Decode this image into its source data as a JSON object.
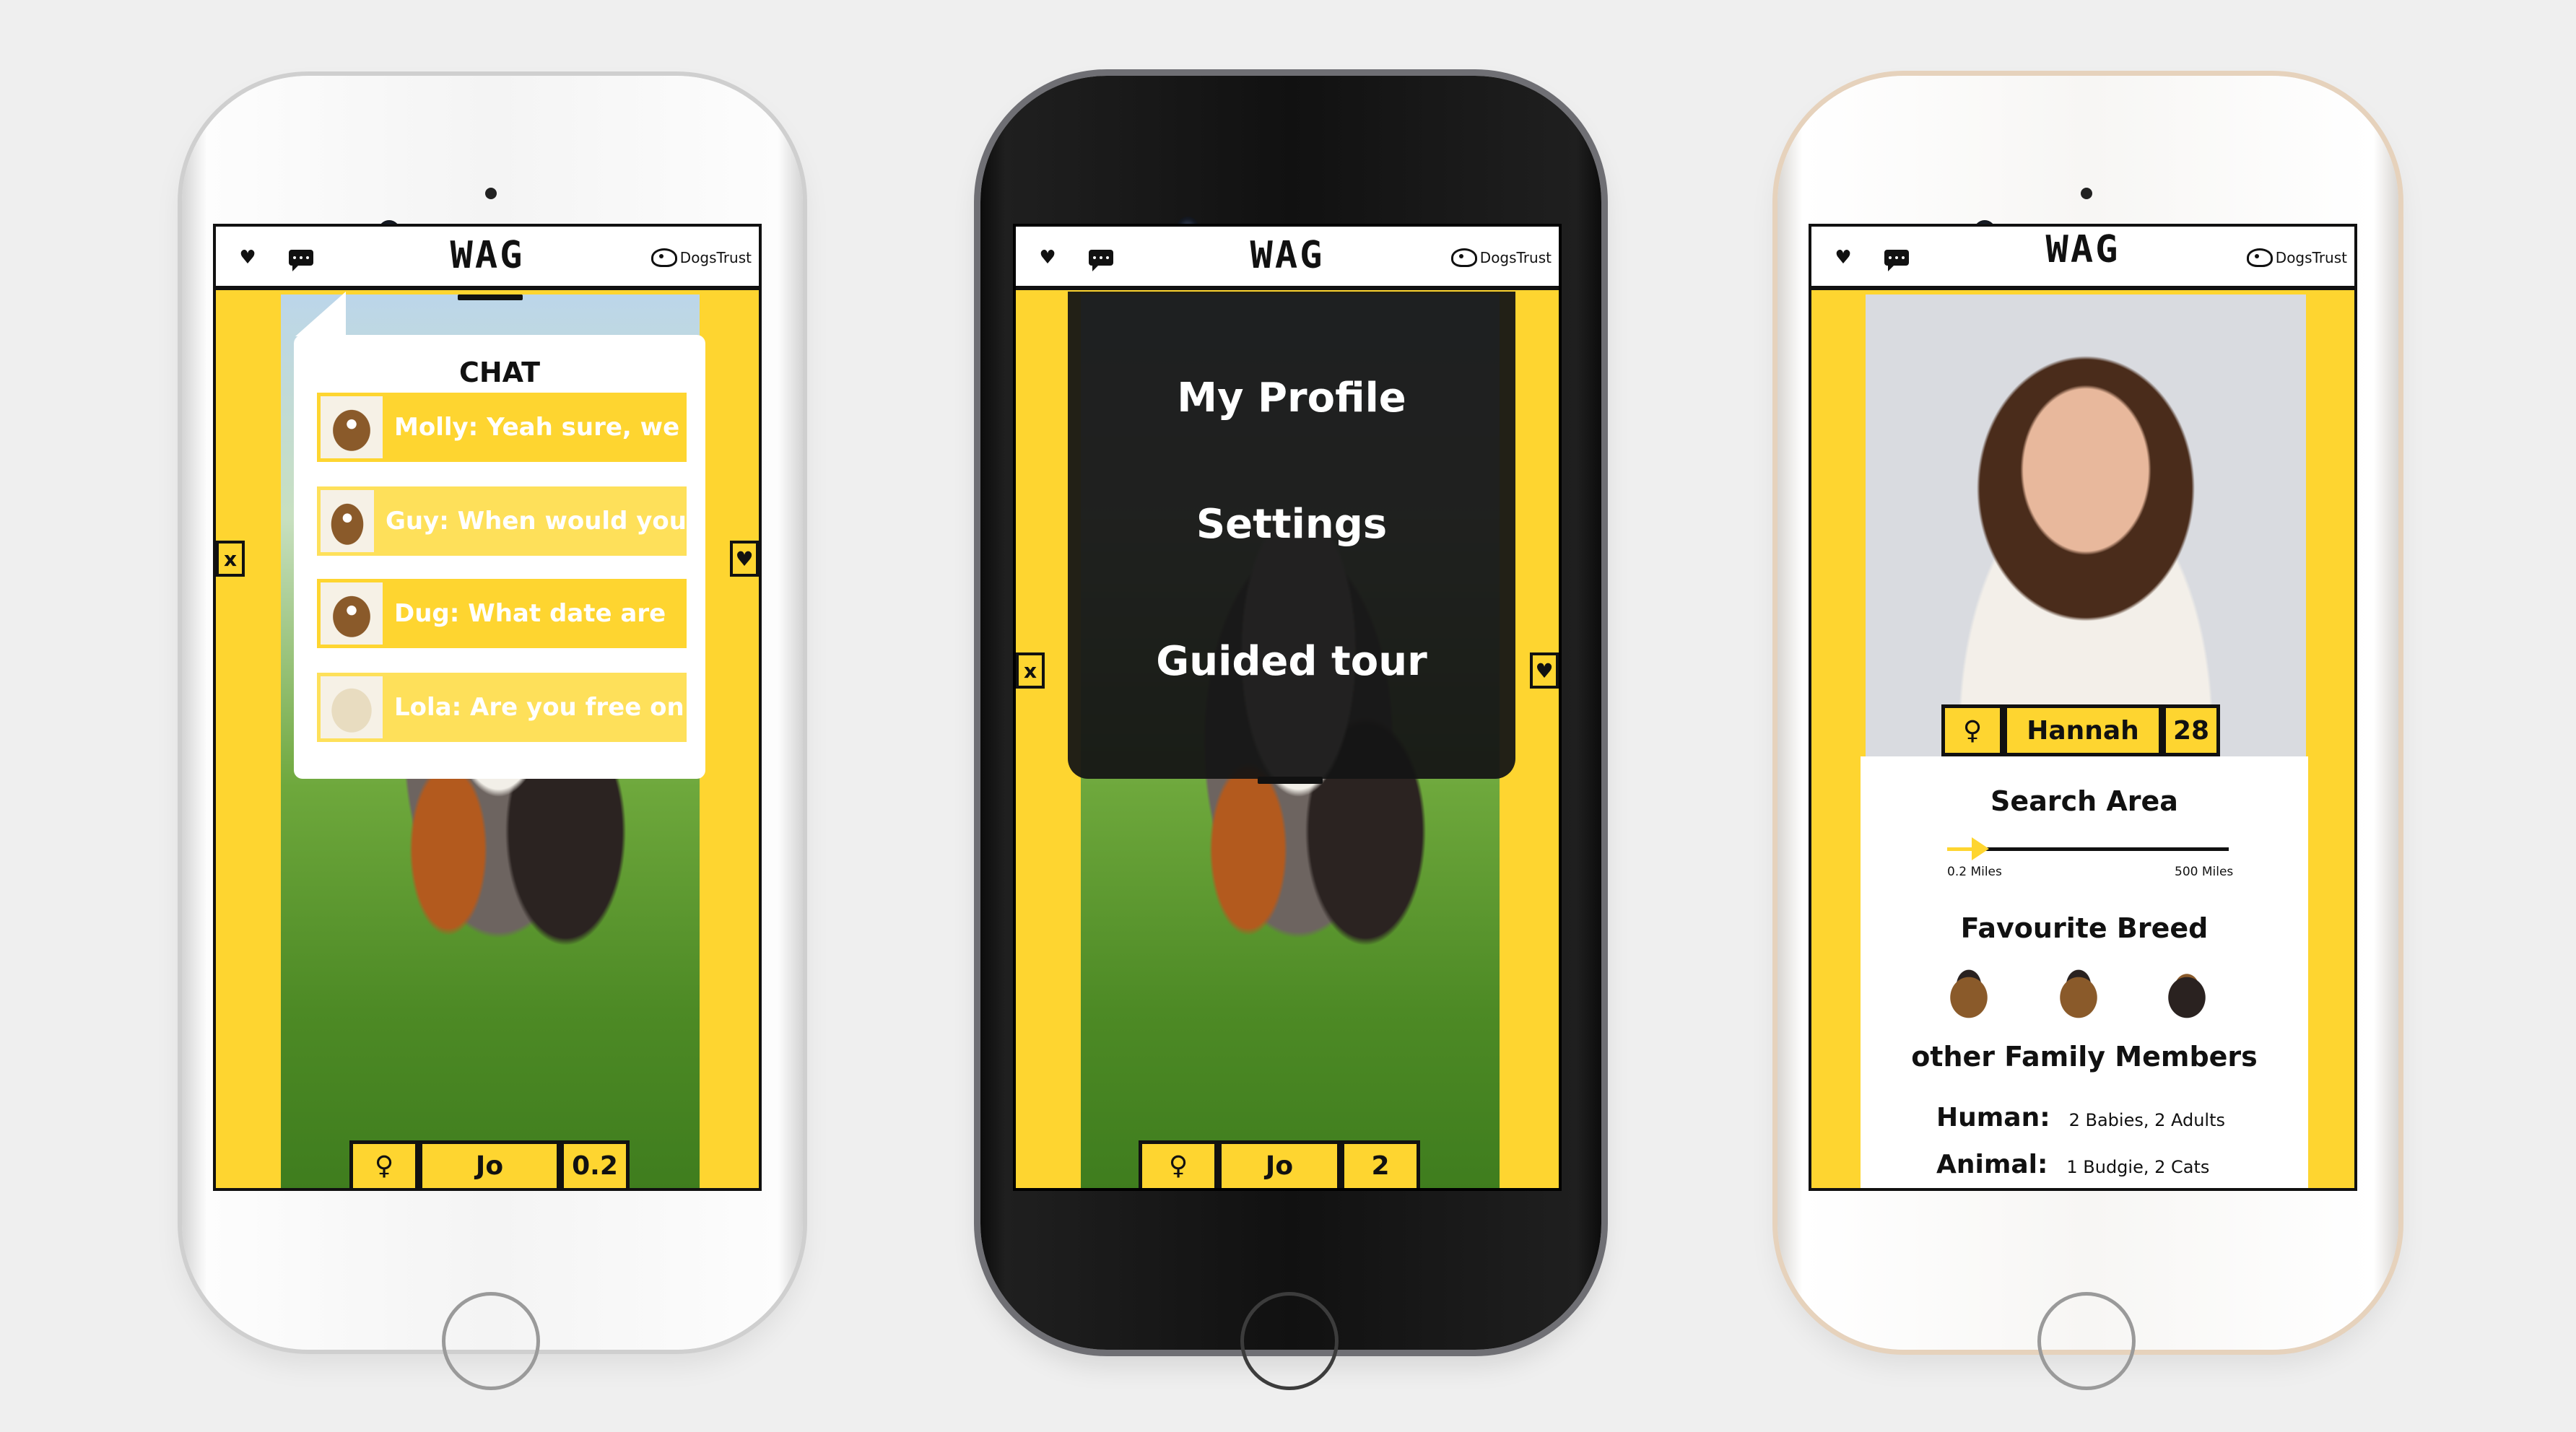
{
  "app": {
    "title": "WAG",
    "brand": "DogsTrust"
  },
  "colors": {
    "accent": "#fed530",
    "dark": "#111111",
    "white": "#ffffff"
  },
  "icons": {
    "favourites": "heart-icon",
    "chat": "chat-bubble-icon",
    "reject": "x-icon",
    "accept": "heart-check-icon",
    "gender": "female-symbol-icon"
  },
  "side_marks": {
    "reject": "x",
    "accept": "♥"
  },
  "screen1": {
    "chat_title": "CHAT",
    "messages": [
      {
        "text": "Molly: Yeah sure, we"
      },
      {
        "text": "Guy: When would you"
      },
      {
        "text": "Dug: What date are"
      },
      {
        "text": "Lola: Are you free on"
      }
    ],
    "bottom": {
      "gender": "♀",
      "name": "Jo",
      "distance": "0.2"
    }
  },
  "screen2": {
    "menu": [
      "My Profile",
      "Settings",
      "Guided tour"
    ],
    "bottom": {
      "gender": "♀",
      "name": "Jo",
      "distance": "2"
    }
  },
  "screen3": {
    "profile": {
      "gender": "♀",
      "name": "Hannah",
      "age": "28"
    },
    "search_area": {
      "label": "Search Area",
      "min_label": "0.2 Miles",
      "max_label": "500 Miles",
      "value_fraction": 0.05
    },
    "favourite_breed": {
      "label": "Favourite Breed"
    },
    "family": {
      "label": "other Family Members",
      "human_label": "Human:",
      "human_value": "2 Babies, 2 Adults",
      "animal_label": "Animal:",
      "animal_value": "1 Budgie, 2 Cats"
    }
  }
}
